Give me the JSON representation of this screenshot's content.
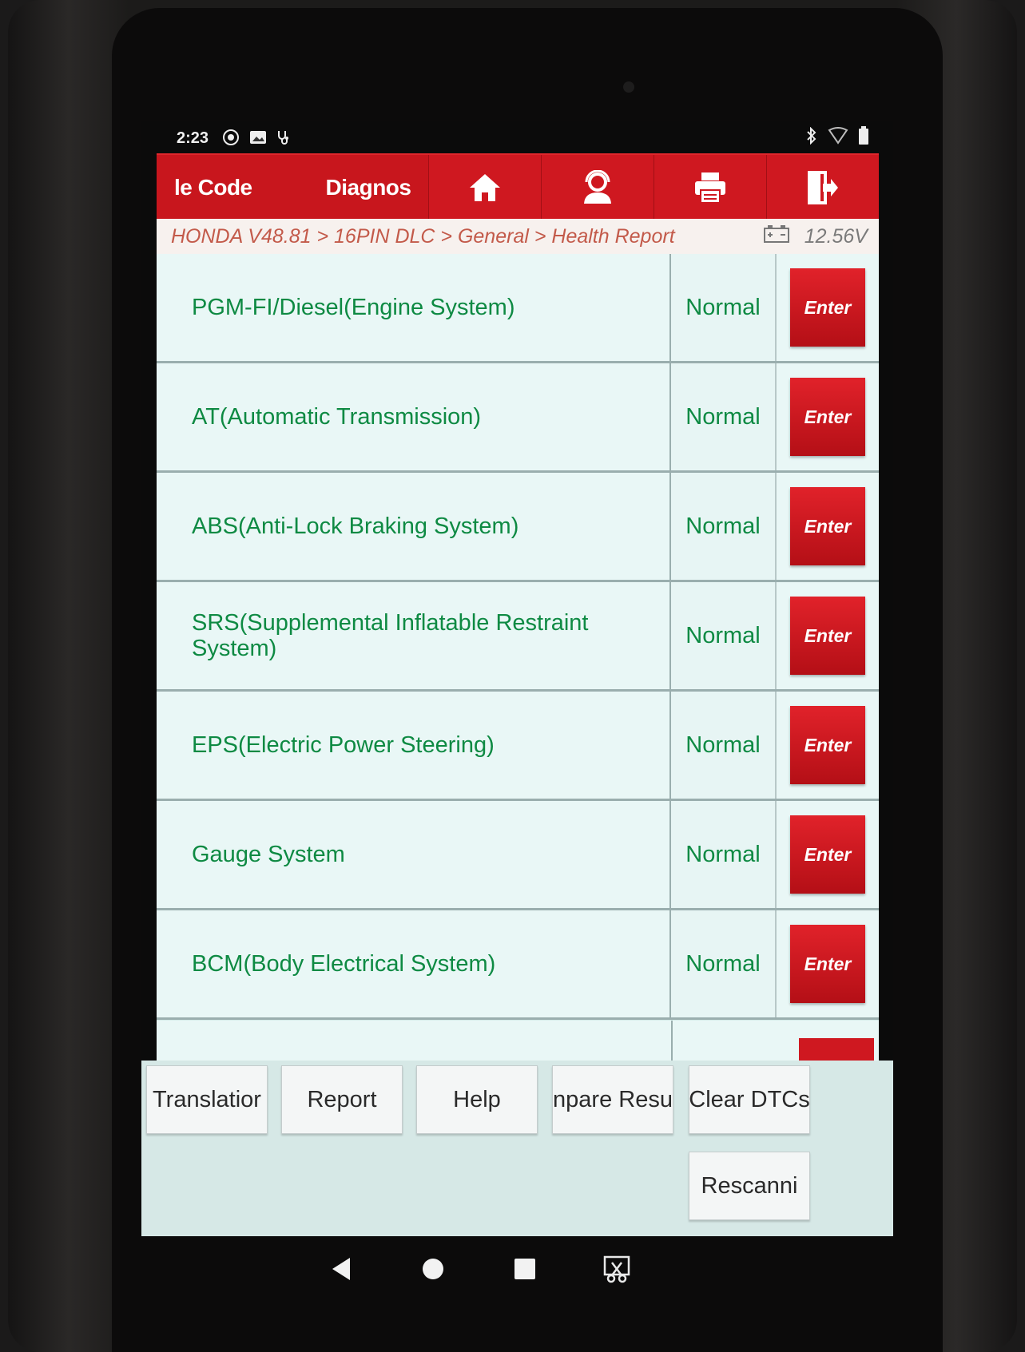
{
  "status_bar": {
    "time": "2:23",
    "icons": [
      "sync-icon",
      "image-icon",
      "stethoscope-icon",
      "bluetooth-icon",
      "wifi-icon",
      "battery-icon"
    ]
  },
  "toolbar": {
    "tab_trouble_code": "le Code",
    "tab_diagnose": "Diagnos",
    "buttons": [
      "home-icon",
      "support-icon",
      "print-icon",
      "exit-icon"
    ],
    "accent_color": "#c8161d"
  },
  "breadcrumb": {
    "path": "HONDA V48.81 > 16PIN DLC > General > Health Report",
    "voltage": "12.56V"
  },
  "systems": [
    {
      "name": "PGM-FI/Diesel(Engine System)",
      "status": "Normal",
      "action": "Enter"
    },
    {
      "name": "AT(Automatic Transmission)",
      "status": "Normal",
      "action": "Enter"
    },
    {
      "name": "ABS(Anti-Lock Braking System)",
      "status": "Normal",
      "action": "Enter"
    },
    {
      "name": "SRS(Supplemental Inflatable Restraint System)",
      "status": "Normal",
      "action": "Enter"
    },
    {
      "name": "EPS(Electric Power Steering)",
      "status": "Normal",
      "action": "Enter"
    },
    {
      "name": "Gauge System",
      "status": "Normal",
      "action": "Enter"
    },
    {
      "name": "BCM(Body Electrical System)",
      "status": "Normal",
      "action": "Enter"
    }
  ],
  "footer_buttons": {
    "translation": "Translatior",
    "report": "Report",
    "help": "Help",
    "compare": "npare Resu",
    "clear_dtcs": "Clear DTCs",
    "rescanning": "Rescanni"
  }
}
